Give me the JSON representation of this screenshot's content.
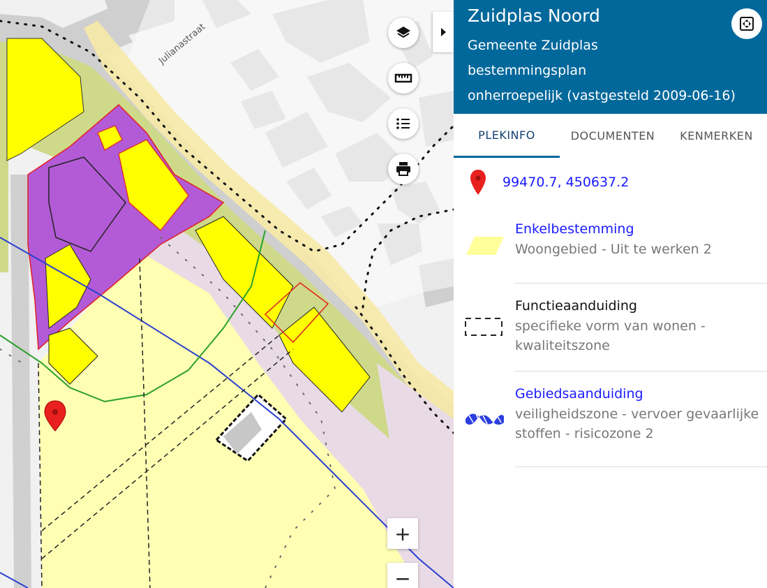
{
  "map": {
    "street_label": "Julianastraat",
    "controls": {
      "layers_icon": "layers-icon",
      "measure_icon": "ruler-icon",
      "legend_icon": "list-icon",
      "print_icon": "printer-icon",
      "zoom_in_label": "+",
      "zoom_out_label": "−"
    }
  },
  "panel": {
    "title": "Zuidplas Noord",
    "municipality": "Gemeente Zuidplas",
    "plan_type": "bestemmingsplan",
    "status": "onherroepelijk (vastgesteld 2009-06-16)",
    "tabs": [
      {
        "label": "PLEKINFO",
        "active": true
      },
      {
        "label": "DOCUMENTEN",
        "active": false
      },
      {
        "label": "KENMERKEN",
        "active": false
      }
    ],
    "coordinates": "99470.7, 450637.2",
    "entries": [
      {
        "title": "Enkelbestemming",
        "subtitle": "Woongebied - Uit te werken 2",
        "icon": "yellow-parallelogram-swatch"
      },
      {
        "title": "Functieaanduiding",
        "subtitle": "specifieke vorm van wonen - kwaliteitszone",
        "icon": "dashed-rectangle-swatch"
      },
      {
        "title": "Gebiedsaanduiding",
        "subtitle": "veiligheidszone - vervoer gevaarlijke stoffen - risicozone 2",
        "icon": "blue-hatched-swatch"
      }
    ]
  },
  "colors": {
    "header_blue": "#01689b",
    "link_blue": "#1a1aff",
    "woon_yellow": "#ffff00",
    "woongebied_light": "#ffffb4",
    "purple": "#b35bd6",
    "green": "#cfd98a",
    "pink": "#ebdde6",
    "marker_red": "#e8201e"
  }
}
